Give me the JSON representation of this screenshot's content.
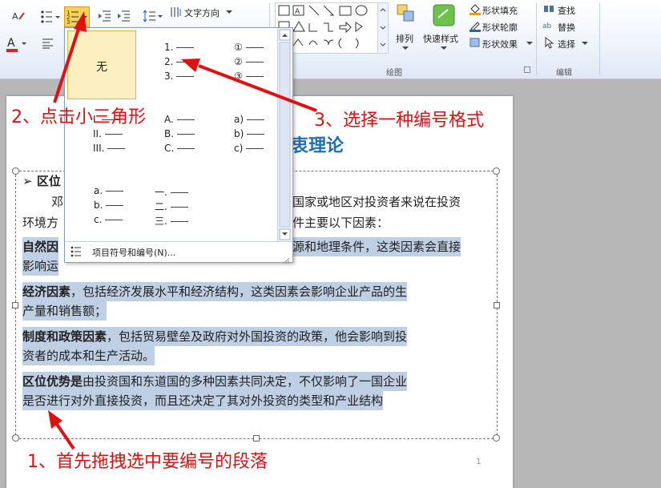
{
  "ribbon": {
    "text_direction": "文字方向",
    "arrange": "排列",
    "quick_styles": "快速样式",
    "shape_fill": "形状填充",
    "shape_outline": "形状轮廓",
    "shape_effects": "形状效果",
    "find": "查找",
    "replace": "替换",
    "select": "选择",
    "group_drawing": "绘图",
    "group_editing": "编辑"
  },
  "dropdown": {
    "none_label": "无",
    "formats": [
      [
        "1.",
        "2.",
        "3."
      ],
      [
        "①",
        "②",
        "③"
      ],
      [
        "I.",
        "II.",
        "III."
      ],
      [
        "A.",
        "B.",
        "C."
      ],
      [
        "a)",
        "b)",
        "c)"
      ],
      [
        "a.",
        "b.",
        "c."
      ],
      [
        "一.",
        "二.",
        "三."
      ]
    ],
    "footer_item": "项目符号和编号(N)..."
  },
  "document": {
    "title": "衷理论",
    "heading_bullet": "➢",
    "heading_text": "区位",
    "line1_left": "邓",
    "line1_right": "国家或地区对投资者来说在投资",
    "line2_left": "环境方",
    "line2_right": "件主要以下因素：",
    "p1_bold": "自然因",
    "p1_rest": "源和地理条件，这类因素会直接",
    "p1_line2": "影响运",
    "p2_bold": "经济因素",
    "p2_rest": "，包括经济发展水平和经济结构，这类因素会影响企业产品的生",
    "p2_line2": "产量和销售额；",
    "p3_bold": "制度和政策因素",
    "p3_rest": "，包括贸易壁垒及政府对外国投资的政策，他会影响到投",
    "p3_line2": "资者的成本和生产活动。",
    "p4_bold": "区位优势是",
    "p4_rest": "由投资国和东道国的多种因素共同决定，不仅影响了一国企业",
    "p4_line2": "是否进行对外直接投资，而且还决定了其对外投资的类型和产业结构",
    "page_num": "1"
  },
  "annotations": {
    "step1": "1、首先拖拽选中要编号的段落",
    "step2": "2、点击小三角形",
    "step3": "3、选择一种编号格式"
  },
  "colors": {
    "annotation_red": "#e01010",
    "title_blue": "#1f6fb5",
    "selection": "#bfcfe4",
    "highlight_gold": "#f7d25a"
  }
}
